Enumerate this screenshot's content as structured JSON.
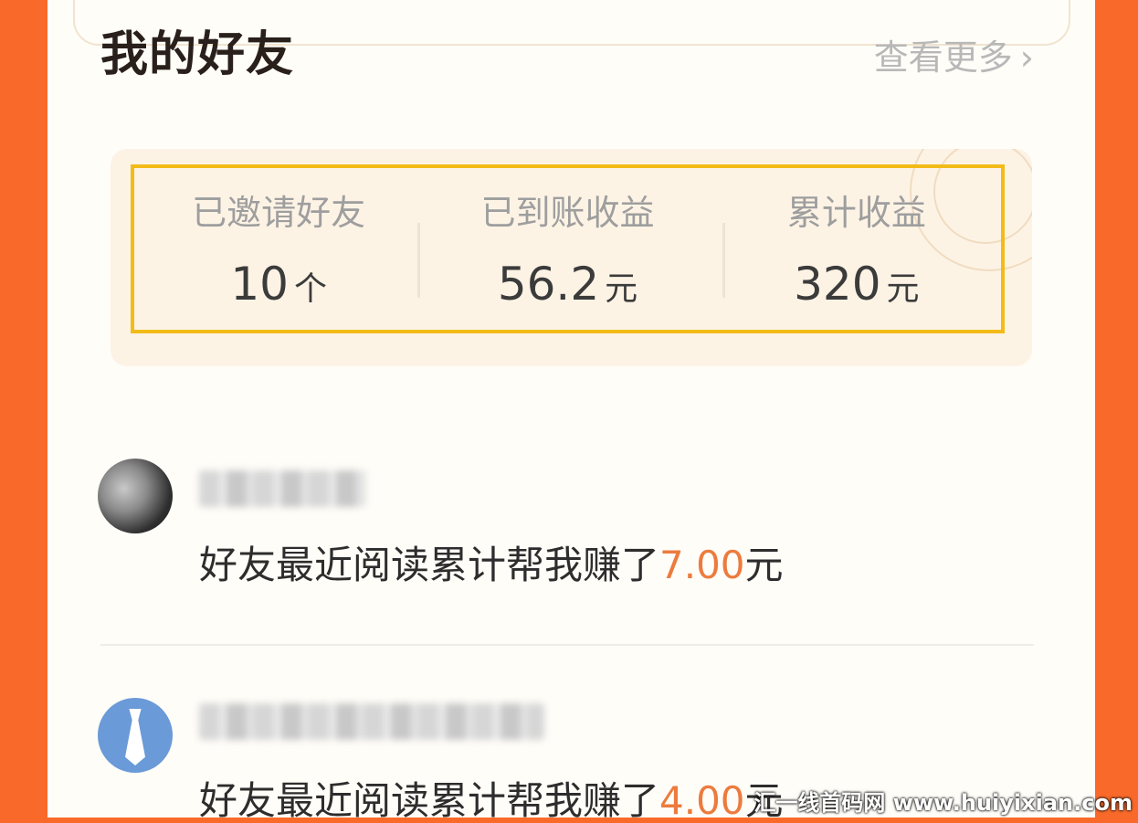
{
  "header": {
    "title": "我的好友",
    "more_label": "查看更多",
    "more_icon": "chevron-right-icon"
  },
  "stats": [
    {
      "label": "已邀请好友",
      "value": "10",
      "unit": "个"
    },
    {
      "label": "已到账收益",
      "value": "56.2",
      "unit": "元"
    },
    {
      "label": "累计收益",
      "value": "320",
      "unit": "元"
    }
  ],
  "friends": [
    {
      "avatar": "photo-avatar",
      "desc_prefix": "好友最近阅读累计帮我赚了",
      "amount": "7.00",
      "unit": "元"
    },
    {
      "avatar": "tie-avatar",
      "desc_prefix": "好友最近阅读累计帮我赚了",
      "amount": "4.00",
      "unit": "元"
    }
  ],
  "watermark": "汇一线首码网 www.huiyixian.com",
  "colors": {
    "background": "#f96a2a",
    "panel": "#fffdf8",
    "highlight_border": "#f2bb17",
    "amount": "#ec7b3e"
  }
}
